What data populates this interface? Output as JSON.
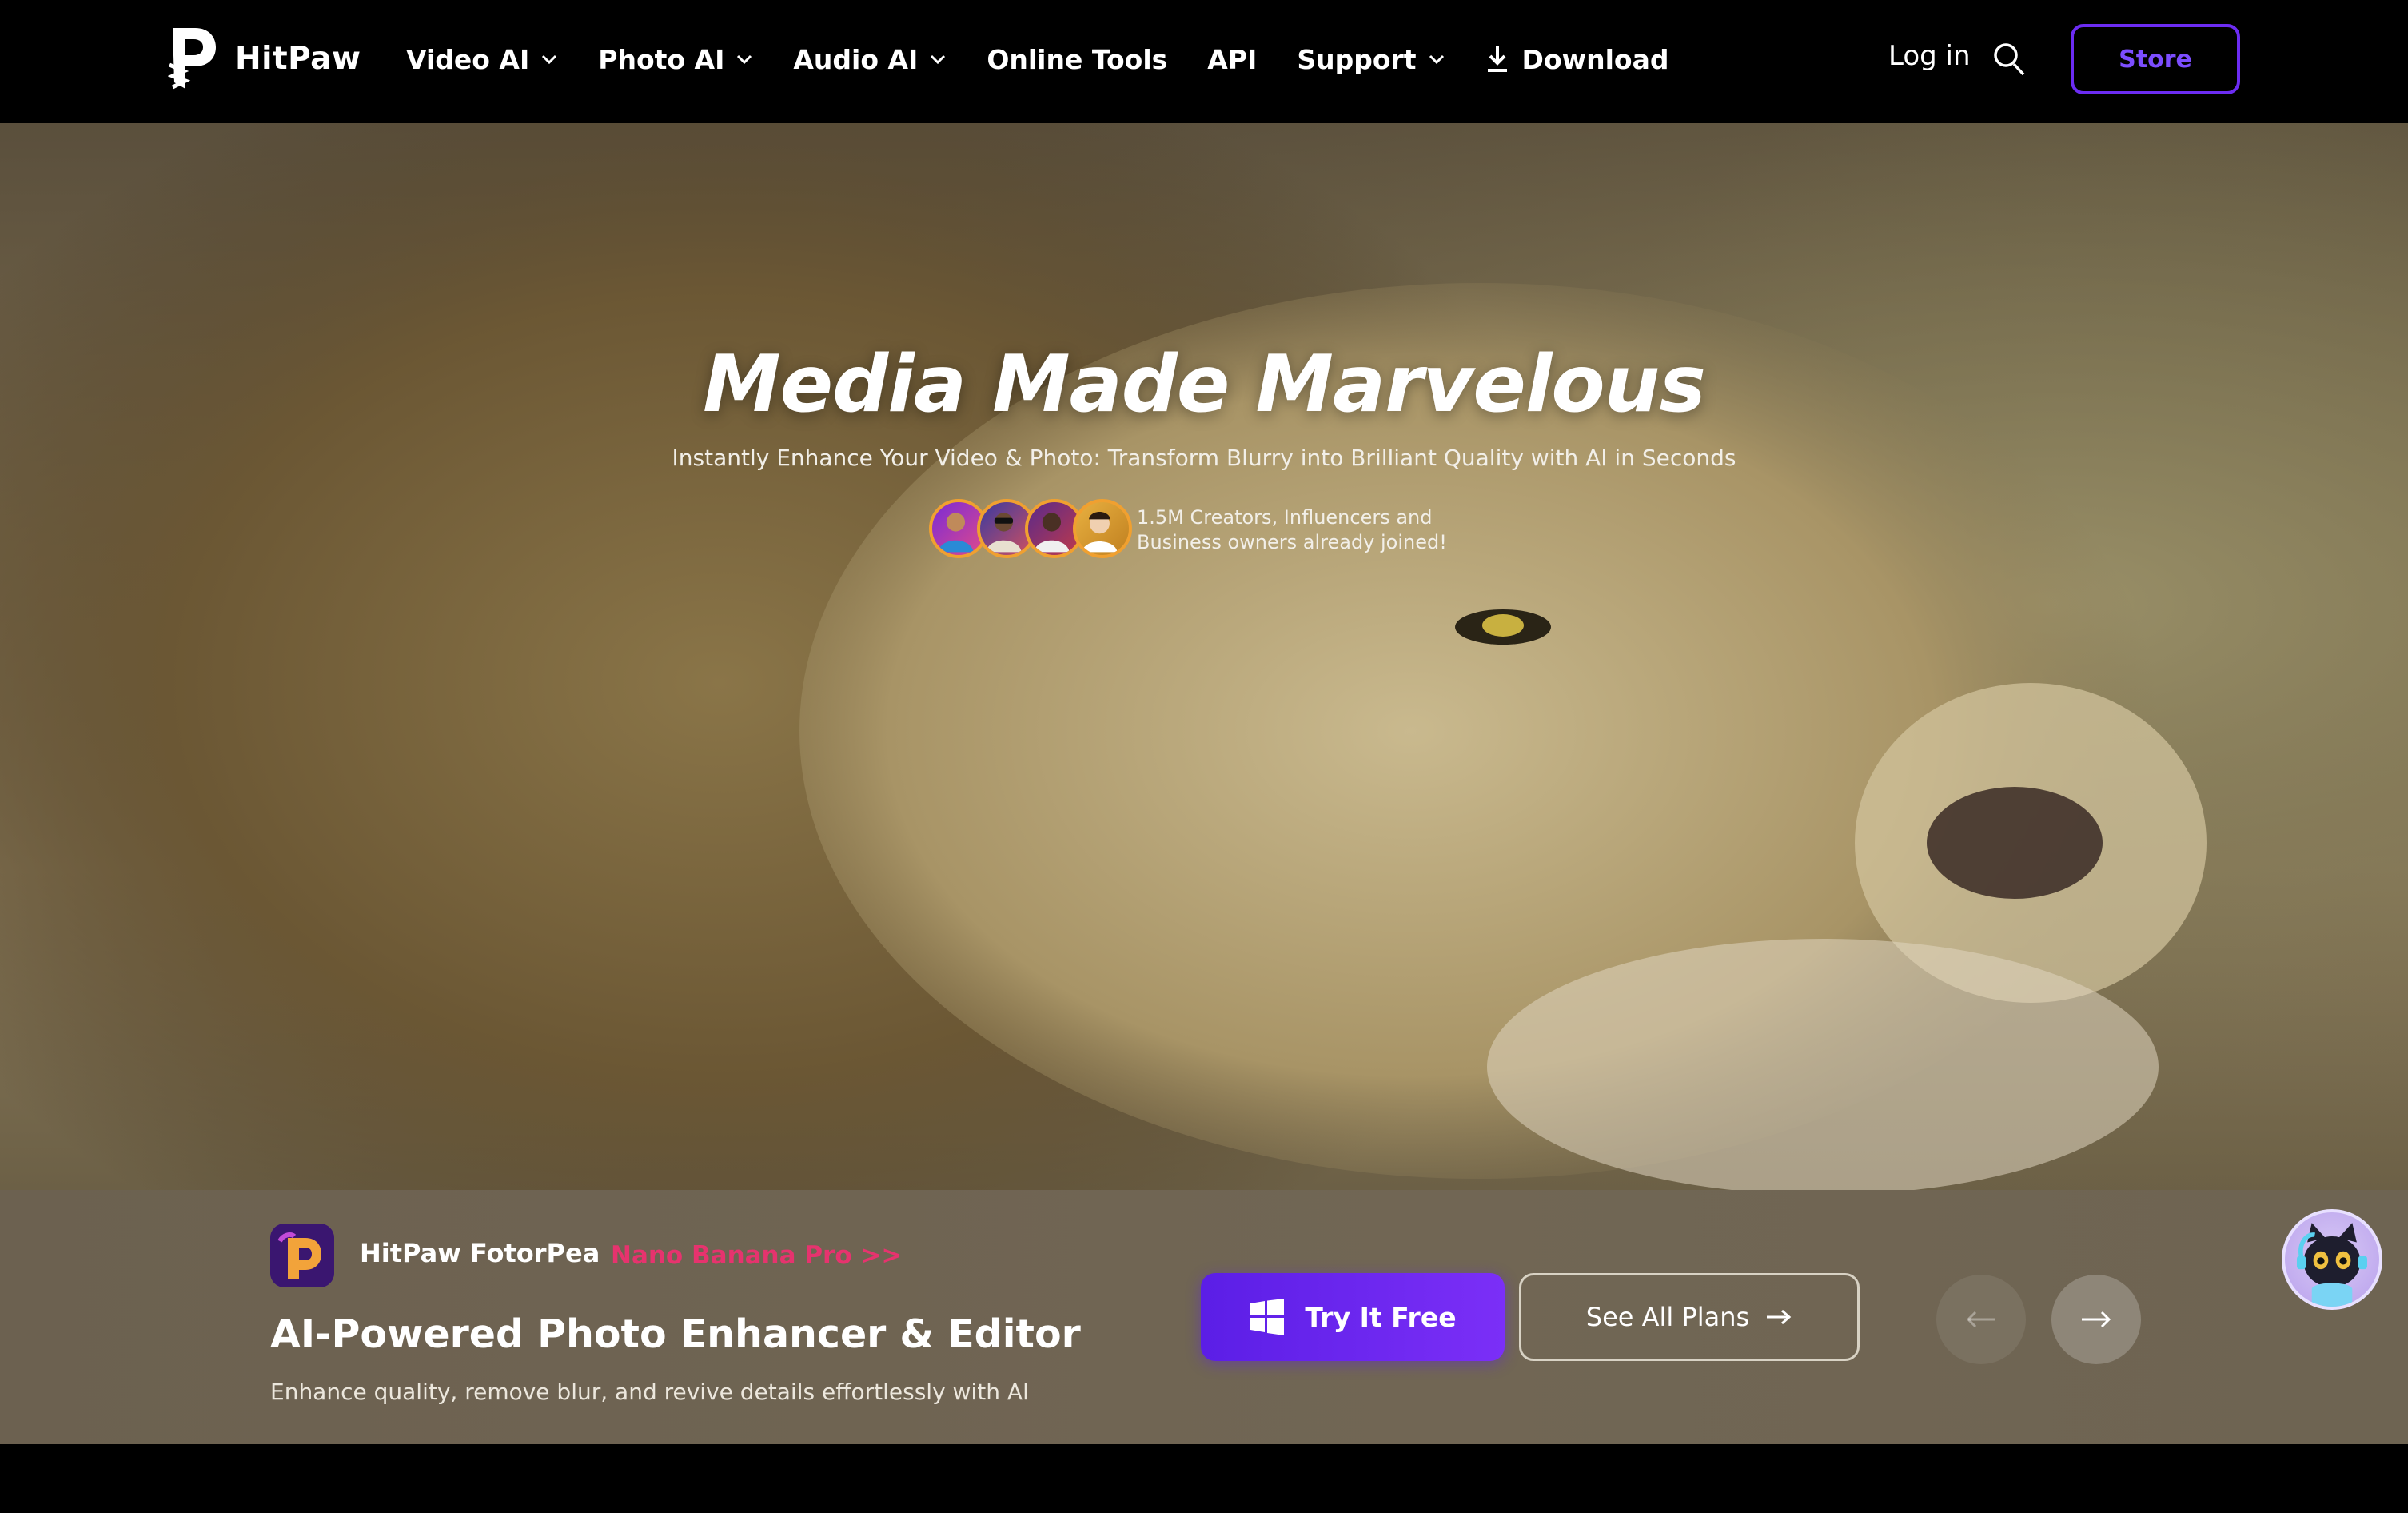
{
  "nav": {
    "logo_text": "HitPaw",
    "menu": [
      {
        "label": "Video AI",
        "has_dropdown": true
      },
      {
        "label": "Photo AI",
        "has_dropdown": true
      },
      {
        "label": "Audio AI",
        "has_dropdown": true
      },
      {
        "label": "Online Tools",
        "has_dropdown": false
      },
      {
        "label": "API",
        "has_dropdown": false
      },
      {
        "label": "Support",
        "has_dropdown": true
      }
    ],
    "download_label": "Download",
    "login_label": "Log in",
    "search_icon": "search-icon",
    "store_label": "Store"
  },
  "hero": {
    "headline": "Media Made Marvelous",
    "subline": "Instantly Enhance Your Video & Photo: Transform Blurry into Brilliant Quality with AI in Seconds",
    "joined_line1": "1.5M Creators, Influencers and",
    "joined_line2": "Business owners already joined!",
    "avatar_count": 4
  },
  "product_bar": {
    "app_name": "HitPaw FotorPea",
    "promo_link": "Nano Banana Pro >>",
    "title": "AI-Powered Photo Enhancer & Editor",
    "description": "Enhance quality, remove blur, and revive details effortlessly with AI",
    "try_label": "Try It Free",
    "plans_label": "See All Plans"
  },
  "colors": {
    "accent": "#6c2cf2",
    "promo": "#e6336e",
    "nav_bg": "#000000"
  }
}
